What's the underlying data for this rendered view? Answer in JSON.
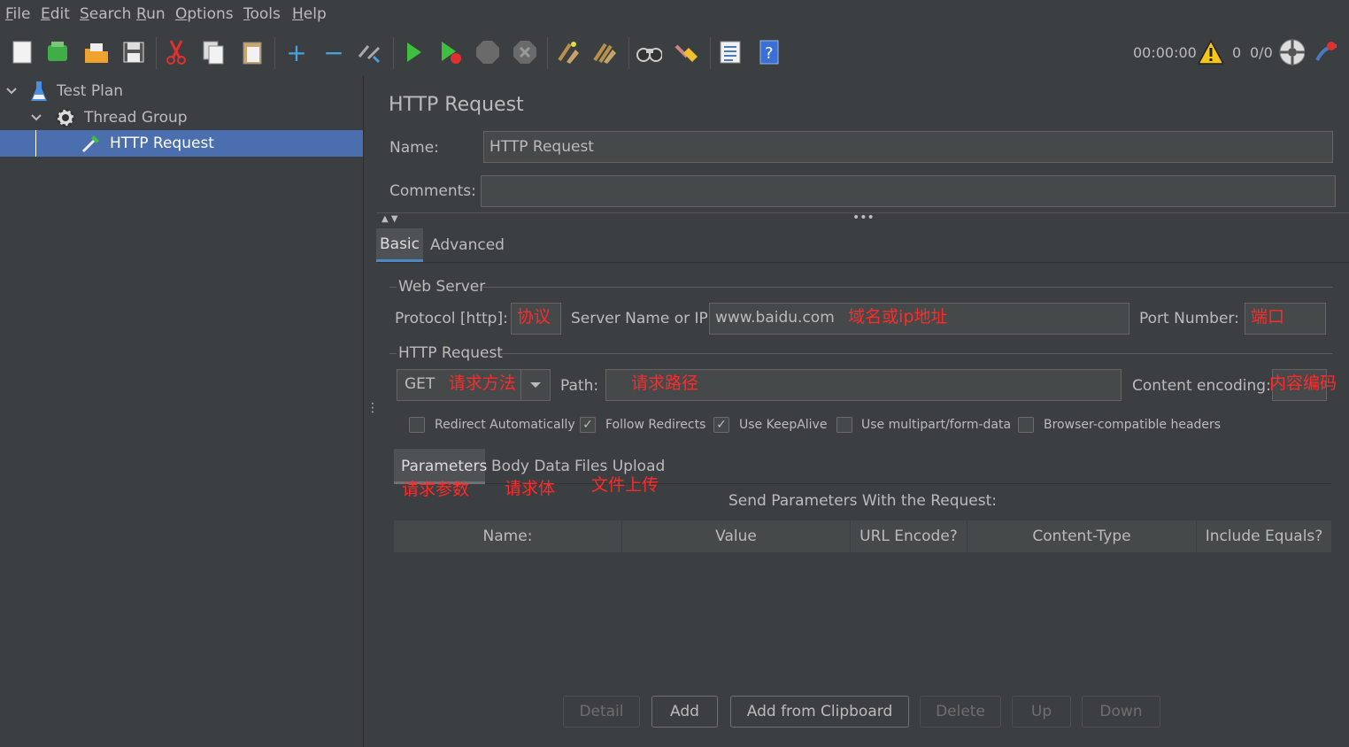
{
  "menu": [
    "File",
    "Edit",
    "Search",
    "Run",
    "Options",
    "Tools",
    "Help"
  ],
  "status": {
    "timer": "00:00:00",
    "warnings": "0",
    "threads": "0/0"
  },
  "tree": {
    "items": [
      "Test Plan",
      "Thread Group",
      "HTTP Request"
    ]
  },
  "panel": {
    "title": "HTTP Request",
    "name_label": "Name:",
    "name_value": "HTTP Request",
    "comments_label": "Comments:",
    "comments_value": "",
    "tabs": [
      "Basic",
      "Advanced"
    ],
    "web_server": {
      "legend": "Web Server",
      "protocol_label": "Protocol [http]:",
      "protocol_note": "协议",
      "server_label": "Server Name or IP:",
      "server_value": "www.baidu.com",
      "server_note": "域名或ip地址",
      "port_label": "Port Number:",
      "port_note": "端口"
    },
    "http_request": {
      "legend": "HTTP Request",
      "method": "GET",
      "method_note": "请求方法",
      "path_label": "Path:",
      "path_note": "请求路径",
      "encoding_label": "Content encoding:",
      "encoding_note": "内容编码"
    },
    "options": [
      {
        "label": "Redirect Automatically",
        "checked": false
      },
      {
        "label": "Follow Redirects",
        "checked": true
      },
      {
        "label": "Use KeepAlive",
        "checked": true
      },
      {
        "label": "Use multipart/form-data",
        "checked": false
      },
      {
        "label": "Browser-compatible headers",
        "checked": false
      }
    ],
    "subtabs": [
      "Parameters",
      "Body Data",
      "Files Upload"
    ],
    "subtab_notes": [
      "请求参数",
      "请求体",
      "文件上传"
    ],
    "params_caption": "Send Parameters With the Request:",
    "columns": [
      "Name:",
      "Value",
      "URL Encode?",
      "Content-Type",
      "Include Equals?"
    ],
    "buttons": [
      "Detail",
      "Add",
      "Add from Clipboard",
      "Delete",
      "Up",
      "Down"
    ]
  }
}
